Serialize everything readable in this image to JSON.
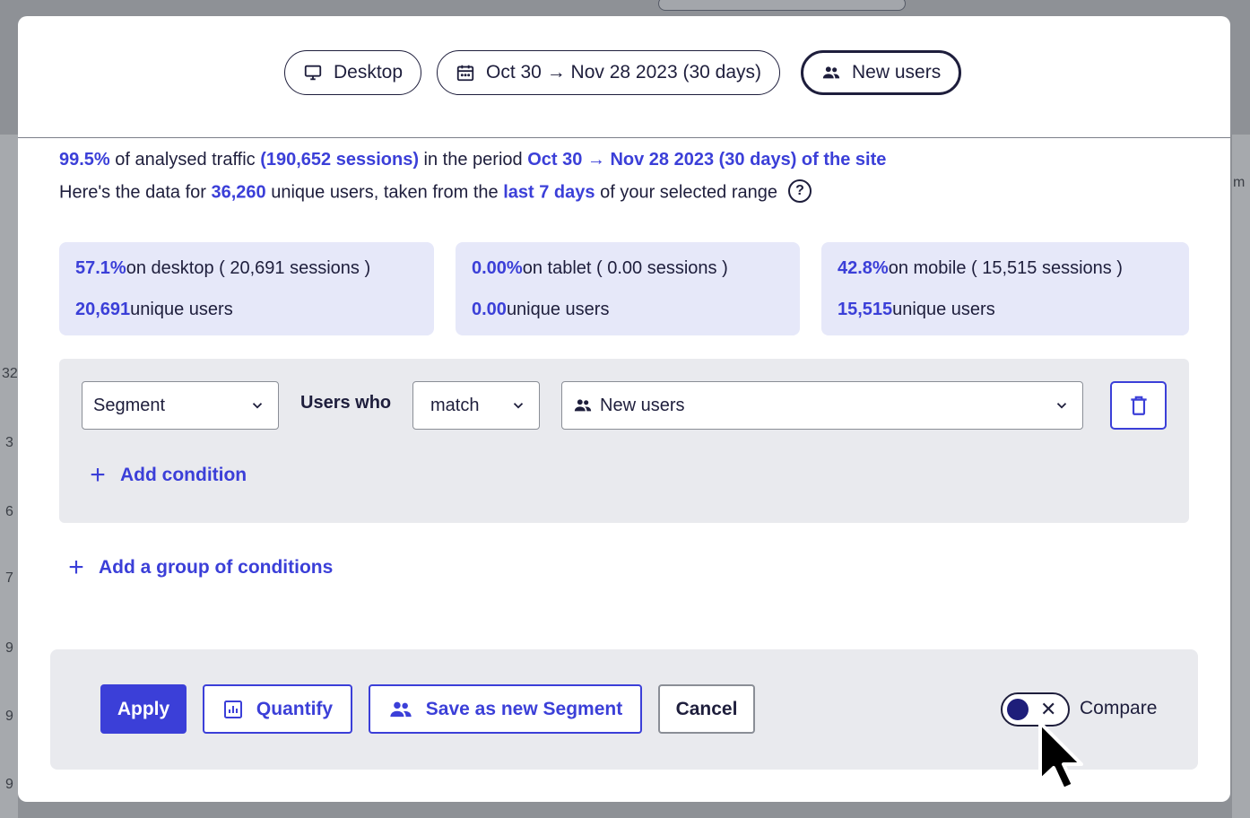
{
  "filters": {
    "device": "Desktop",
    "date_range": "Oct 30 → Nov 28 2023 (30 days)",
    "segment": "New users"
  },
  "summary": {
    "line1": {
      "pct": "99.5%",
      "text_a": " of analysed traffic ",
      "sessions": "(190,652 sessions)",
      "text_b": " in the period ",
      "period": "Oct 30 → Nov 28 2023 (30 days) of the site"
    },
    "line2": {
      "text_a": "Here's the data for ",
      "users": "36,260",
      "text_b": " unique users, taken from the ",
      "window": "last 7 days",
      "text_c": " of your selected range",
      "help": "?"
    }
  },
  "cards": [
    {
      "pct": "57.1%",
      "label": " on desktop ( 20,691 sessions )",
      "users": "20,691",
      "users_label": " unique users"
    },
    {
      "pct": "0.00%",
      "label": " on tablet ( 0.00 sessions )",
      "users": "0.00",
      "users_label": " unique users"
    },
    {
      "pct": "42.8%",
      "label": " on mobile ( 15,515 sessions )",
      "users": "15,515",
      "users_label": " unique users"
    }
  ],
  "condition": {
    "type": "Segment",
    "who_label": "Users who",
    "operator": "match",
    "value": "New users",
    "add_condition": "Add condition"
  },
  "add_group": "Add a group of conditions",
  "footer": {
    "apply": "Apply",
    "quantify": "Quantify",
    "save_segment": "Save as new Segment",
    "cancel": "Cancel",
    "compare_label": "Compare",
    "compare_x": "✕"
  },
  "background": {
    "edge_right": "m",
    "edge_left": [
      "32",
      "3",
      "6",
      "7",
      "9",
      "9",
      "9"
    ]
  },
  "colors": {
    "accent": "#3b3fd8",
    "text": "#1e1e3c",
    "card_bg": "#e6e8f9",
    "panel_bg": "#e9eaee"
  }
}
